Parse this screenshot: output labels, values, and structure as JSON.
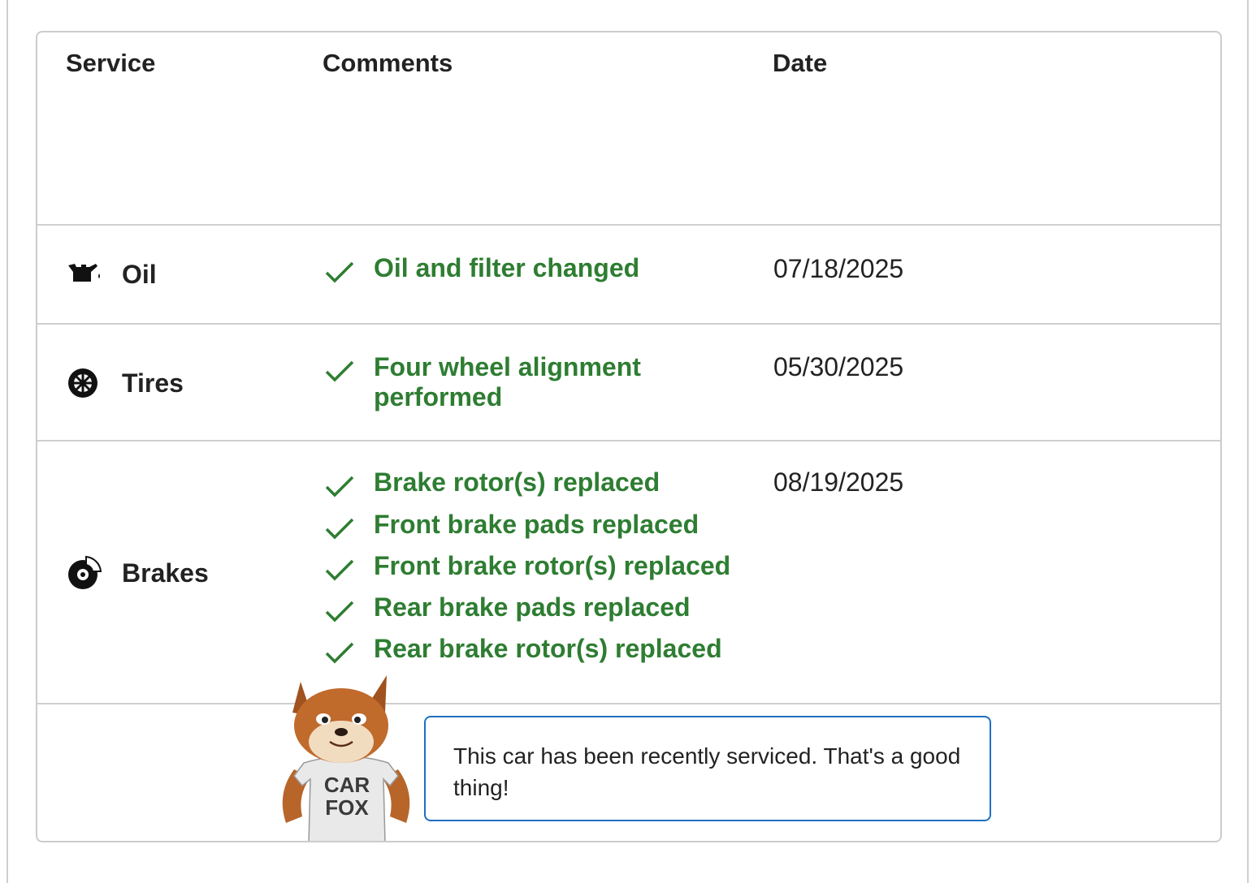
{
  "table": {
    "headers": {
      "service": "Service",
      "comments": "Comments",
      "date": "Date"
    },
    "rows": [
      {
        "service": "Oil",
        "icon": "oil-can-icon",
        "comments": [
          "Oil and filter changed"
        ],
        "date": "07/18/2025"
      },
      {
        "service": "Tires",
        "icon": "tire-icon",
        "comments": [
          "Four wheel alignment performed"
        ],
        "date": "05/30/2025"
      },
      {
        "service": "Brakes",
        "icon": "brake-disc-icon",
        "comments": [
          "Brake rotor(s) replaced",
          "Front brake pads replaced",
          "Front brake rotor(s) replaced",
          "Rear brake pads replaced",
          "Rear brake rotor(s) replaced"
        ],
        "date": "08/19/2025"
      }
    ]
  },
  "callout": {
    "message": "This car has been recently serviced. That's a good thing!",
    "mascot_shirt_line1": "CAR",
    "mascot_shirt_line2": "FOX"
  },
  "colors": {
    "comment_green": "#2e7d32",
    "callout_border": "#1e6fc2",
    "divider": "#cfcfcf"
  }
}
